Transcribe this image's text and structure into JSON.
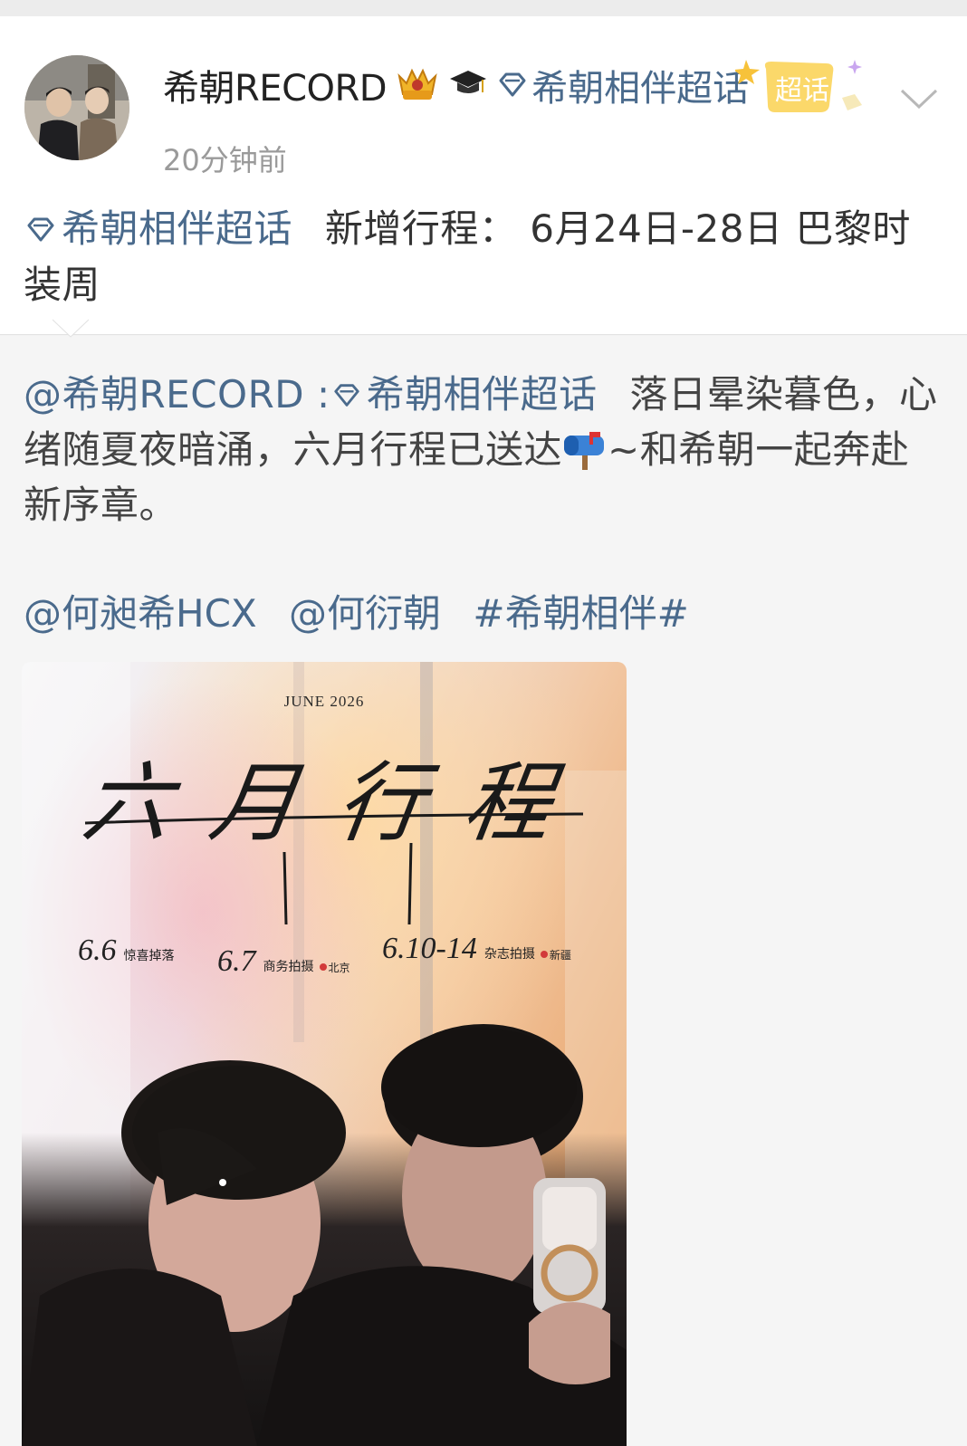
{
  "post": {
    "username": "希朝RECORD",
    "topic_tag": "希朝相伴超话",
    "supertopic_badge_label": "超话",
    "timestamp": "20分钟前",
    "text_topic": "希朝相伴超话",
    "text_body": "新增行程： 6月24日-28日 巴黎时装周"
  },
  "repost": {
    "author_mention": "@希朝RECORD",
    "topic": "希朝相伴超话",
    "text_part1": "落日晕染暮色，心绪随夏夜暗涌，六月行程已送达",
    "text_part2": "~和希朝一起奔赴新序章。",
    "mentions": [
      "@何昶希HCX",
      "@何衍朝",
      "#希朝相伴#"
    ]
  },
  "poster": {
    "month_label": "JUNE 2026",
    "title": "六月行程",
    "schedule": [
      {
        "date": "6.6",
        "event": "惊喜掉落",
        "location": ""
      },
      {
        "date": "6.7",
        "event": "商务拍摄",
        "location": "北京"
      },
      {
        "date": "6.10-14",
        "event": "杂志拍摄",
        "location": "新疆"
      }
    ]
  },
  "icons": {
    "crown_badge": "crown-badge-icon",
    "grad_cap": "graduation-cap-icon",
    "diamond": "supertopic-diamond-icon",
    "chevron": "chevron-down-icon",
    "mailbox": "mailbox-emoji-icon"
  },
  "colors": {
    "link": "#4a6a8c",
    "timestamp": "#9a9a9a",
    "repost_bg": "#f5f5f5"
  }
}
